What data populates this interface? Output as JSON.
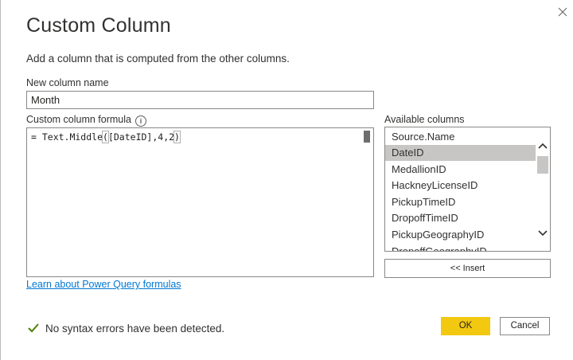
{
  "dialog": {
    "title": "Custom Column",
    "subtitle": "Add a column that is computed from the other columns."
  },
  "new_column": {
    "label": "New column name",
    "value": "Month"
  },
  "formula": {
    "label": "Custom column formula",
    "prefix": "= Text.Middle",
    "open_paren": "(",
    "middle": "[DateID],4,2",
    "close_paren": ")"
  },
  "available_columns": {
    "label": "Available columns",
    "items": [
      "Source.Name",
      "DateID",
      "MedallionID",
      "HackneyLicenseID",
      "PickupTimeID",
      "DropoffTimeID",
      "PickupGeographyID",
      "DropoffGeographyID"
    ],
    "selected_index": 1,
    "insert_label": "<< Insert"
  },
  "learn_link": "Learn about Power Query formulas",
  "status": {
    "text": "No syntax errors have been detected.",
    "color": "#498205"
  },
  "buttons": {
    "ok": "OK",
    "cancel": "Cancel"
  },
  "colors": {
    "accent": "#f2c811",
    "link": "#0078d4",
    "selected": "#c8c6c4"
  }
}
